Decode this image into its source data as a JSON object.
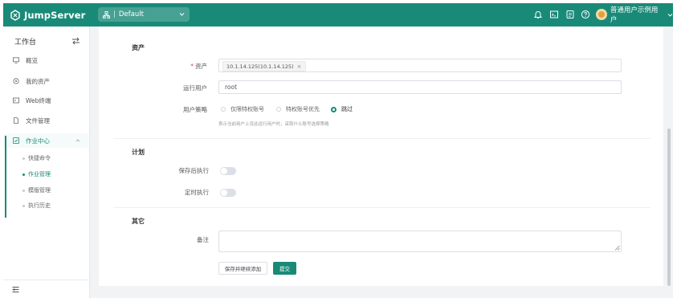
{
  "app": {
    "name": "JumpServer"
  },
  "header": {
    "org_prefix": "|",
    "org_name": "Default",
    "username": "普通用户示例用户"
  },
  "sidebar": {
    "title": "工作台",
    "items": [
      {
        "label": "概览"
      },
      {
        "label": "我的资产"
      },
      {
        "label": "Web终端"
      },
      {
        "label": "文件管理"
      },
      {
        "label": "作业中心"
      }
    ],
    "subitems": [
      {
        "label": "快捷命令"
      },
      {
        "label": "作业管理"
      },
      {
        "label": "模版管理"
      },
      {
        "label": "执行历史"
      }
    ]
  },
  "form": {
    "section_assets": "资产",
    "asset_label": "资产",
    "asset_required_mark": "*",
    "asset_tag": "10.1.14.125(10.1.14.125)",
    "asset_tag_remove": "×",
    "runas_label": "运行用户",
    "runas_value": "root",
    "policy_label": "用户策略",
    "policy_options": [
      "仅限特权账号",
      "特权账号优先",
      "跳过"
    ],
    "policy_selected": "跳过",
    "policy_hint": "表示当前用户上没此运行用户时，采取什么账号选择策略",
    "section_plan": "计划",
    "run_after_save_label": "保存后执行",
    "run_after_save": false,
    "scheduled_label": "定时执行",
    "scheduled": false,
    "section_other": "其它",
    "comment_label": "备注",
    "comment_value": "",
    "save_continue_label": "保存并继续添加",
    "submit_label": "提交"
  },
  "colors": {
    "brand": "#1a8a78",
    "required": "#e0454a"
  }
}
